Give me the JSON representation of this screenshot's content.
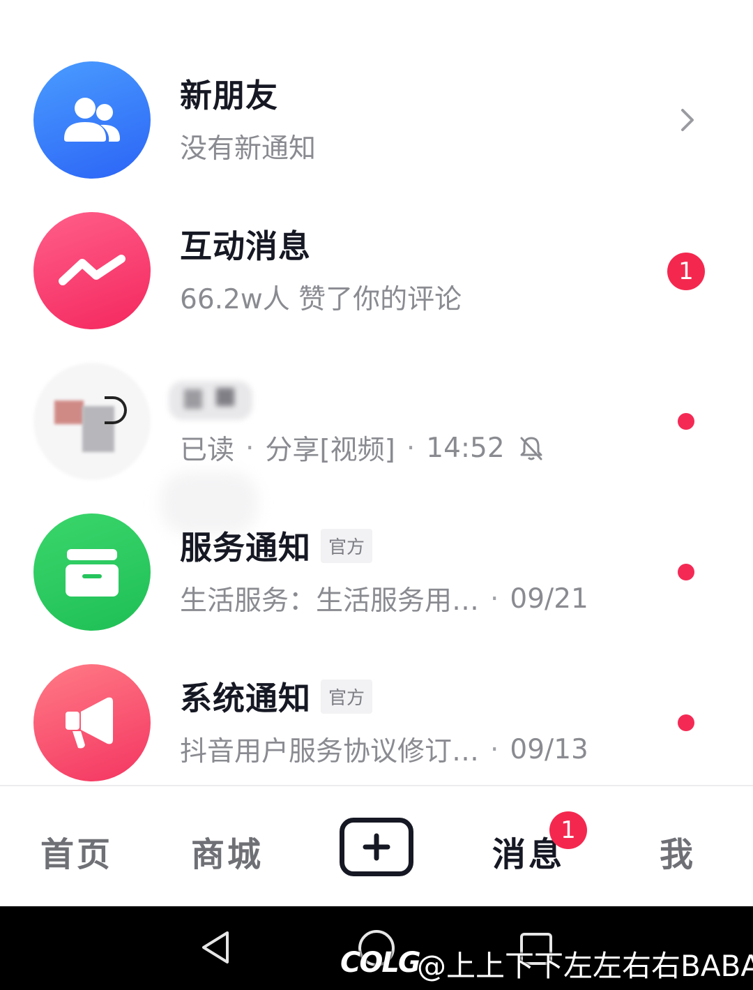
{
  "messages": [
    {
      "title": "新朋友",
      "subtitle": "没有新通知",
      "icon": "people-icon",
      "color": "#2f6cf8"
    },
    {
      "title": "互动消息",
      "subtitle": "66.2w人 赞了你的评论",
      "badge": "1",
      "icon": "zigzag-icon",
      "color": "#f42f63"
    },
    {
      "subtitle_status": "已读",
      "subtitle_action": "分享[视频]",
      "time": "14:52",
      "muted_icon": "bell-off-icon"
    },
    {
      "title": "服务通知",
      "tag": "官方",
      "subtitle": "生活服务：生活服务用…",
      "date": "09/21",
      "icon": "inbox-icon",
      "color": "#25c45c"
    },
    {
      "title": "系统通知",
      "tag": "官方",
      "subtitle": "抖音用户服务协议修订…",
      "date": "09/13",
      "icon": "megaphone-icon",
      "color": "#f43c66"
    }
  ],
  "tabbar": {
    "home": "首页",
    "mall": "商城",
    "add_icon": "plus-icon",
    "messages": "消息",
    "messages_badge": "1",
    "me": "我"
  },
  "watermark": {
    "logo": "COLG",
    "text": "@上上下下左左右右BABA"
  },
  "colors": {
    "badge_red": "#f4284f",
    "text_primary": "#161823",
    "text_secondary": "#8a8b91"
  }
}
